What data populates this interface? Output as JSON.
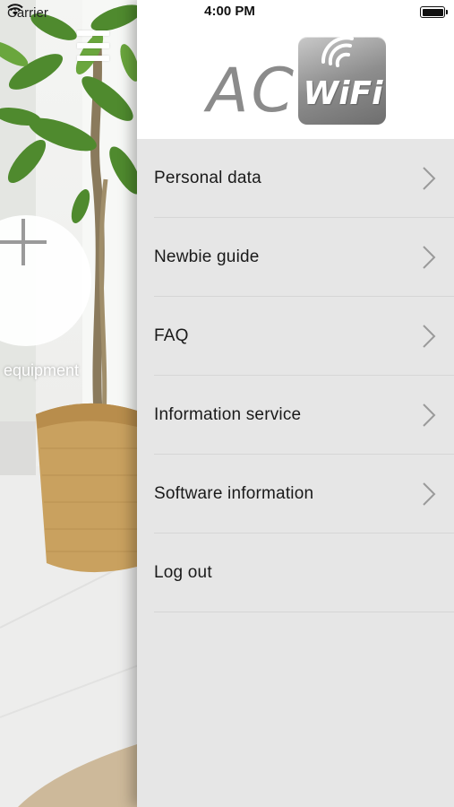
{
  "status_bar": {
    "carrier": "Carrier",
    "time": "4:00 PM"
  },
  "background": {
    "add_label": "equipment"
  },
  "drawer": {
    "logo": {
      "ac_text": "AC",
      "wifi_text": "WiFi"
    },
    "menu_items": [
      {
        "label": "Personal data",
        "has_chevron": true
      },
      {
        "label": "Newbie guide",
        "has_chevron": true
      },
      {
        "label": "FAQ",
        "has_chevron": true
      },
      {
        "label": "Information service",
        "has_chevron": true
      },
      {
        "label": "Software information",
        "has_chevron": true
      },
      {
        "label": "Log out",
        "has_chevron": false
      }
    ]
  },
  "icons": {
    "menu": "hamburger-icon",
    "add": "plus-icon",
    "wifi": "wifi-icon",
    "battery": "battery-icon",
    "chevron": "chevron-right-icon"
  },
  "colors": {
    "drawer_background": "#e6e6e6",
    "header_background": "#ffffff",
    "text": "#1a1a1a",
    "chevron": "#9a9a9a"
  }
}
